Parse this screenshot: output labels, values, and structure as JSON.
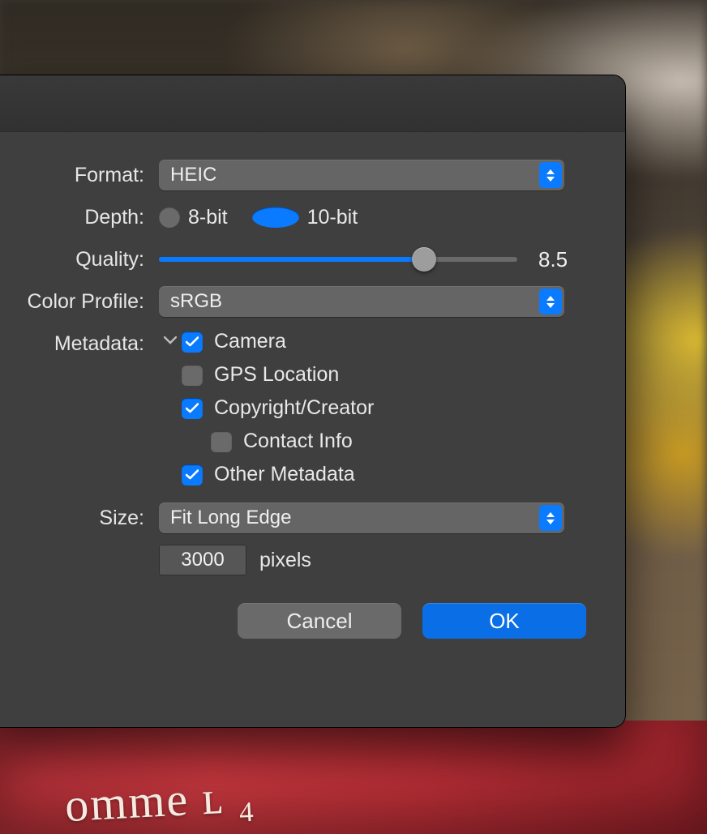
{
  "backdrop_scrawl": "omme  ʟ ₄",
  "labels": {
    "format": "Format:",
    "depth": "Depth:",
    "quality": "Quality:",
    "color_profile": "Color Profile:",
    "metadata": "Metadata:",
    "size": "Size:"
  },
  "format": {
    "value": "HEIC"
  },
  "depth": {
    "options": {
      "eight": "8-bit",
      "ten": "10-bit"
    },
    "selected": "10-bit"
  },
  "quality": {
    "value": "8.5",
    "percent": 74
  },
  "color_profile": {
    "value": "sRGB"
  },
  "metadata": {
    "camera": {
      "label": "Camera",
      "checked": true
    },
    "gps": {
      "label": "GPS Location",
      "checked": false
    },
    "copyright": {
      "label": "Copyright/Creator",
      "checked": true
    },
    "contact": {
      "label": "Contact Info",
      "checked": false,
      "indent": true
    },
    "other": {
      "label": "Other Metadata",
      "checked": true
    }
  },
  "size": {
    "value": "Fit Long Edge",
    "pixels": "3000",
    "unit": "pixels"
  },
  "buttons": {
    "cancel": "Cancel",
    "ok": "OK"
  }
}
